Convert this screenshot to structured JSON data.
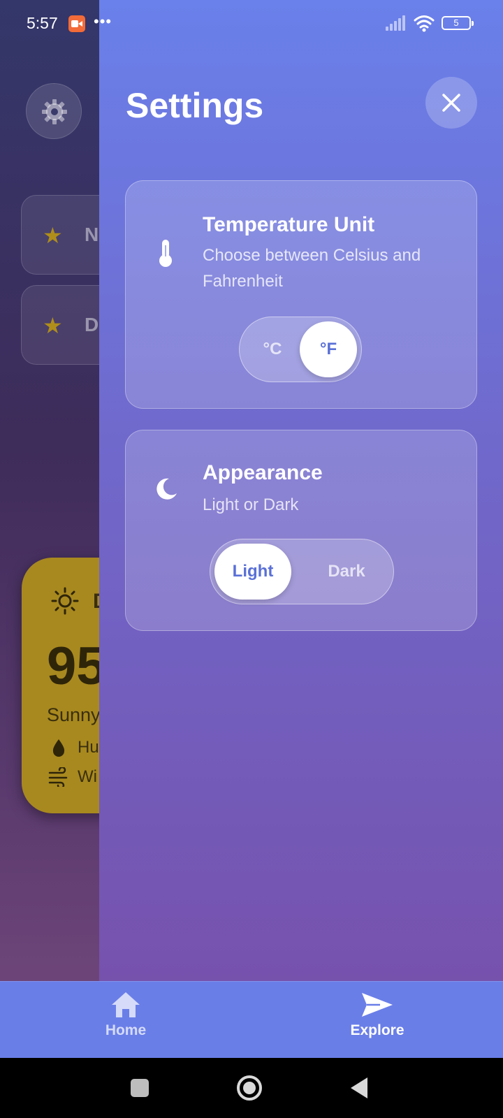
{
  "status_bar": {
    "time": "5:57",
    "battery": "5",
    "recording_icon": "screen-record-icon",
    "more_icon": "more-dots-icon",
    "signal_icon": "signal-icon",
    "wifi_icon": "wifi-icon"
  },
  "background": {
    "settings_icon": "gear-icon",
    "favorites": [
      {
        "icon": "star-icon",
        "label_fragment": "N"
      },
      {
        "icon": "star-icon",
        "label_fragment": "D"
      }
    ],
    "weather_card": {
      "icon": "sun-icon",
      "city_fragment": "D",
      "temp_fragment": "95",
      "condition_fragment": "Sunny",
      "humidity_fragment": "Hu",
      "wind_fragment": "Wi",
      "color": "#a8891f"
    }
  },
  "drawer": {
    "title": "Settings",
    "close_icon": "close-icon",
    "temperature": {
      "title": "Temperature Unit",
      "description": "Choose between Celsius and Fahrenheit",
      "icon": "thermometer-icon",
      "options": [
        "°C",
        "°F"
      ],
      "selected": "°F"
    },
    "appearance": {
      "title": "Appearance",
      "description": "Light or Dark",
      "icon": "moon-icon",
      "options": [
        "Light",
        "Dark"
      ],
      "selected": "Light"
    }
  },
  "bottom_nav": {
    "items": [
      {
        "label": "Home",
        "icon": "home-icon",
        "active": false
      },
      {
        "label": "Explore",
        "icon": "send-icon",
        "active": true
      }
    ]
  },
  "colors": {
    "drawer_top": "#6a80ea",
    "drawer_bottom": "#7652ad",
    "accent_text": "#5a70d6",
    "nav_bar": "#6a7ee8"
  }
}
